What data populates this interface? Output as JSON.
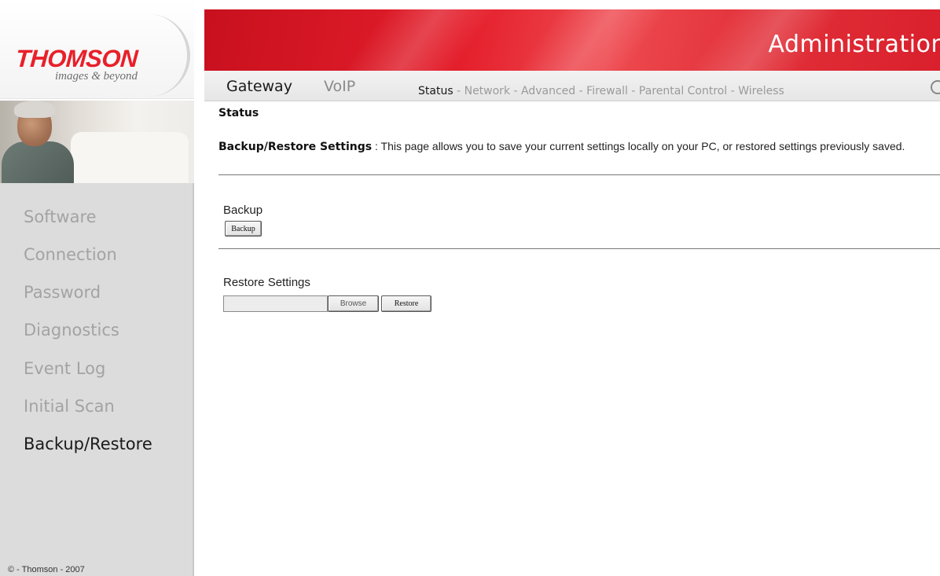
{
  "brand": {
    "logo_text": "THOMSON",
    "tagline": "images & beyond",
    "primary_color": "#e8202a"
  },
  "header": {
    "title": "Administration",
    "tabs": [
      {
        "label": "Gateway",
        "active": true
      },
      {
        "label": "VoIP",
        "active": false
      }
    ],
    "sub_nav": [
      {
        "label": "Status",
        "active": true
      },
      {
        "label": "Network",
        "active": false
      },
      {
        "label": "Advanced",
        "active": false
      },
      {
        "label": "Firewall",
        "active": false
      },
      {
        "label": "Parental Control",
        "active": false
      },
      {
        "label": "Wireless",
        "active": false
      }
    ],
    "sub_nav_separator": "-"
  },
  "sidebar": {
    "items": [
      {
        "label": "Software",
        "active": false
      },
      {
        "label": "Connection",
        "active": false
      },
      {
        "label": "Password",
        "active": false
      },
      {
        "label": "Diagnostics",
        "active": false
      },
      {
        "label": "Event Log",
        "active": false
      },
      {
        "label": "Initial Scan",
        "active": false
      },
      {
        "label": "Backup/Restore",
        "active": true
      }
    ],
    "copyright": "© - Thomson - 2007"
  },
  "main": {
    "heading": "Status",
    "description_title": "Backup/Restore Settings",
    "description_separator": ":",
    "description_text": "This page allows you to save your current settings locally on your PC, or restored settings previously saved.",
    "backup": {
      "label": "Backup",
      "button_label": "Backup"
    },
    "restore": {
      "label": "Restore Settings",
      "file_value": "",
      "browse_label": "Browse",
      "restore_button_label": "Restore"
    }
  }
}
